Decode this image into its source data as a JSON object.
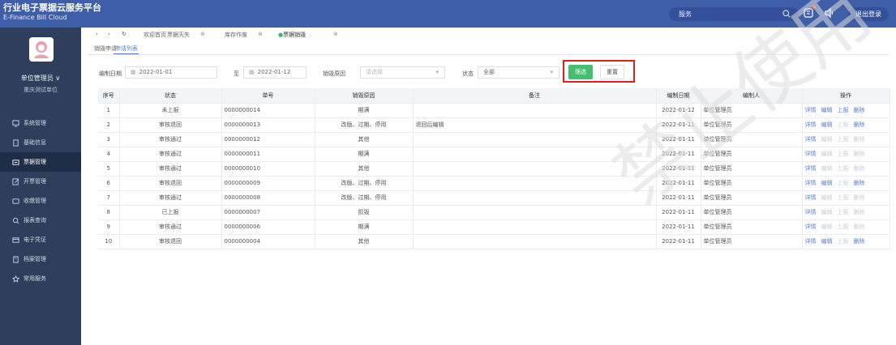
{
  "header": {
    "title_cn": "行业电子票据云服务平台",
    "title_en": "E-Finance Bill Cloud",
    "search_placeholder": "服务",
    "logout_label": "退出登录",
    "bg_color": "#3f5ea8"
  },
  "sidebar": {
    "user": "单位管理员 ∨",
    "unit": "重庆测试单位",
    "items": [
      {
        "label": "系统管理",
        "icon": "monitor-icon"
      },
      {
        "label": "基础信息",
        "icon": "document-icon"
      },
      {
        "label": "票据管理",
        "icon": "ticket-icon",
        "active": true
      },
      {
        "label": "开票管理",
        "icon": "edit-icon"
      },
      {
        "label": "收缴管理",
        "icon": "wallet-icon"
      },
      {
        "label": "报表查询",
        "icon": "search-icon"
      },
      {
        "label": "电子凭证",
        "icon": "card-icon"
      },
      {
        "label": "档案管理",
        "icon": "archive-icon"
      },
      {
        "label": "常用服务",
        "icon": "star-icon"
      }
    ]
  },
  "tabs": [
    {
      "label": "欢迎首页"
    },
    {
      "label": "票据灭失"
    },
    {
      "label": "库存作废"
    },
    {
      "label": "票据销毁",
      "active": true
    }
  ],
  "subtabs": [
    "销毁申请",
    "申请列表"
  ],
  "filters": {
    "date_label": "编制日期",
    "date_from": "2022-01-01",
    "to_label": "至",
    "date_to": "2022-01-12",
    "reason_label": "销毁原因",
    "reason_placeholder": "请选择",
    "status_label": "状态",
    "status_value": "全部",
    "filter_button": "筛选",
    "reset_button": "重置"
  },
  "table": {
    "headers": [
      "序号",
      "状态",
      "单号",
      "销毁原因",
      "备注",
      "编制日期",
      "编制人",
      "操作"
    ],
    "rows": [
      {
        "no": "1",
        "status": "未上报",
        "id": "0000000014",
        "reason": "期满",
        "note": "",
        "date": "2022-01-12",
        "creator": "单位管理员",
        "ops": [
          "详情",
          "编辑",
          "上报",
          "删除"
        ],
        "disabled": []
      },
      {
        "no": "2",
        "status": "审核退回",
        "id": "0000000013",
        "reason": "改版、过期、停用",
        "note": "退回后编辑",
        "date": "2022-01-11",
        "creator": "单位管理员",
        "ops": [
          "详情",
          "编辑",
          "上报",
          "删除"
        ],
        "disabled": [
          2
        ]
      },
      {
        "no": "3",
        "status": "审核通过",
        "id": "0000000012",
        "reason": "其他",
        "note": "",
        "date": "2022-01-11",
        "creator": "单位管理员",
        "ops": [
          "详情",
          "编辑",
          "上报",
          "删除"
        ],
        "disabled": [
          1,
          2,
          3
        ]
      },
      {
        "no": "4",
        "status": "审核通过",
        "id": "0000000011",
        "reason": "期满",
        "note": "",
        "date": "2022-01-11",
        "creator": "单位管理员",
        "ops": [
          "详情",
          "编辑",
          "上报",
          "删除"
        ],
        "disabled": [
          1,
          2,
          3
        ]
      },
      {
        "no": "5",
        "status": "审核通过",
        "id": "0000000010",
        "reason": "其他",
        "note": "",
        "date": "2022-01-11",
        "creator": "单位管理员",
        "ops": [
          "详情",
          "编辑",
          "上报",
          "删除"
        ],
        "disabled": [
          1,
          2,
          3
        ]
      },
      {
        "no": "6",
        "status": "审核退回",
        "id": "0000000009",
        "reason": "改版、过期、停用",
        "note": "",
        "date": "2022-01-11",
        "creator": "单位管理员",
        "ops": [
          "详情",
          "编辑",
          "上报",
          "删除"
        ],
        "disabled": [
          2
        ]
      },
      {
        "no": "7",
        "status": "审核通过",
        "id": "0000000008",
        "reason": "改版、过期、停用",
        "note": "",
        "date": "2022-01-11",
        "creator": "单位管理员",
        "ops": [
          "详情",
          "编辑",
          "上报",
          "删除"
        ],
        "disabled": [
          1,
          2,
          3
        ]
      },
      {
        "no": "8",
        "status": "已上报",
        "id": "0000000007",
        "reason": "损毁",
        "note": "",
        "date": "2022-01-11",
        "creator": "单位管理员",
        "ops": [
          "详情",
          "编辑",
          "上报",
          "删除"
        ],
        "disabled": [
          1,
          2,
          3
        ]
      },
      {
        "no": "9",
        "status": "审核通过",
        "id": "0000000006",
        "reason": "期满",
        "note": "",
        "date": "2022-01-11",
        "creator": "单位管理员",
        "ops": [
          "详情",
          "编辑",
          "上报",
          "删除"
        ],
        "disabled": [
          1,
          2,
          3
        ]
      },
      {
        "no": "10",
        "status": "审核退回",
        "id": "0000000004",
        "reason": "其他",
        "note": "",
        "date": "2022-01-11",
        "creator": "单位管理员",
        "ops": [
          "详情",
          "编辑",
          "上报",
          "删除"
        ],
        "disabled": [
          2
        ]
      }
    ]
  },
  "watermark_text": "禁止使用"
}
